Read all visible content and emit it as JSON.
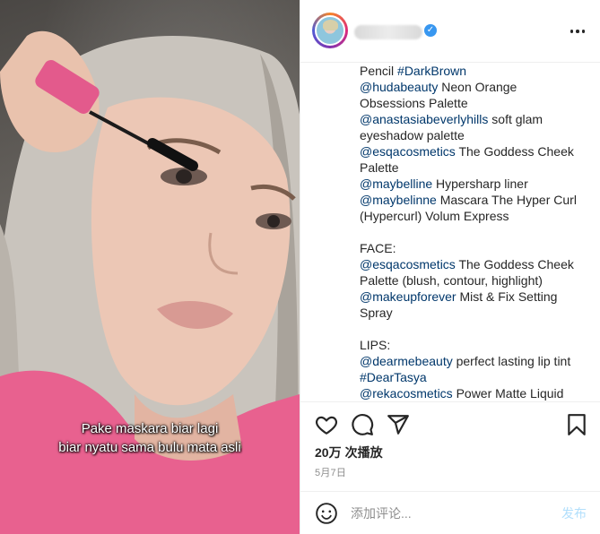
{
  "video": {
    "caption_lines": [
      "Pake maskara biar lagi",
      "biar nyatu sama bulu mata asli"
    ]
  },
  "header": {
    "verified_mark": "✓"
  },
  "post_text": [
    [
      {
        "t": "Pencil "
      },
      {
        "t": "#DarkBrown",
        "k": "hashtag"
      }
    ],
    [
      {
        "t": "@hudabeauty",
        "k": "mention"
      },
      {
        "t": " Neon Orange"
      }
    ],
    [
      {
        "t": "Obsessions Palette"
      }
    ],
    [
      {
        "t": "@anastasiabeverlyhills",
        "k": "mention"
      },
      {
        "t": " soft glam"
      }
    ],
    [
      {
        "t": "eyeshadow palette"
      }
    ],
    [
      {
        "t": "@esqacosmetics",
        "k": "mention"
      },
      {
        "t": " The Goddess Cheek"
      }
    ],
    [
      {
        "t": "Palette"
      }
    ],
    [
      {
        "t": "@maybelline",
        "k": "mention"
      },
      {
        "t": " Hypersharp liner"
      }
    ],
    [
      {
        "t": "@maybelinne",
        "k": "mention"
      },
      {
        "t": " Mascara The Hyper Curl"
      }
    ],
    [
      {
        "t": "(Hypercurl) Volum Express"
      }
    ],
    [],
    [
      {
        "t": "FACE:"
      }
    ],
    [
      {
        "t": "@esqacosmetics",
        "k": "mention"
      },
      {
        "t": " The Goddess Cheek"
      }
    ],
    [
      {
        "t": "Palette (blush, contour, highlight)"
      }
    ],
    [
      {
        "t": "@makeupforever",
        "k": "mention"
      },
      {
        "t": " Mist & Fix Setting"
      }
    ],
    [
      {
        "t": "Spray"
      }
    ],
    [],
    [
      {
        "t": "LIPS:"
      }
    ],
    [
      {
        "t": "@dearmebeauty",
        "k": "mention"
      },
      {
        "t": " perfect lasting lip tint"
      }
    ],
    [
      {
        "t": "#DearTasya",
        "k": "hashtag"
      }
    ],
    [
      {
        "t": "@rekacosmetics",
        "k": "mention"
      },
      {
        "t": " Power Matte Liquid"
      }
    ]
  ],
  "stats": {
    "views_count": "20万",
    "views_label": "次播放",
    "date": "5月7日"
  },
  "actions": {
    "icons": [
      "heart-icon",
      "comment-icon",
      "share-icon",
      "bookmark-icon"
    ]
  },
  "comment_box": {
    "placeholder": "添加评论...",
    "post_label": "发布"
  },
  "colors": {
    "link": "#00376b",
    "post_disabled": "#b2dffc",
    "verified": "#3897f0"
  }
}
